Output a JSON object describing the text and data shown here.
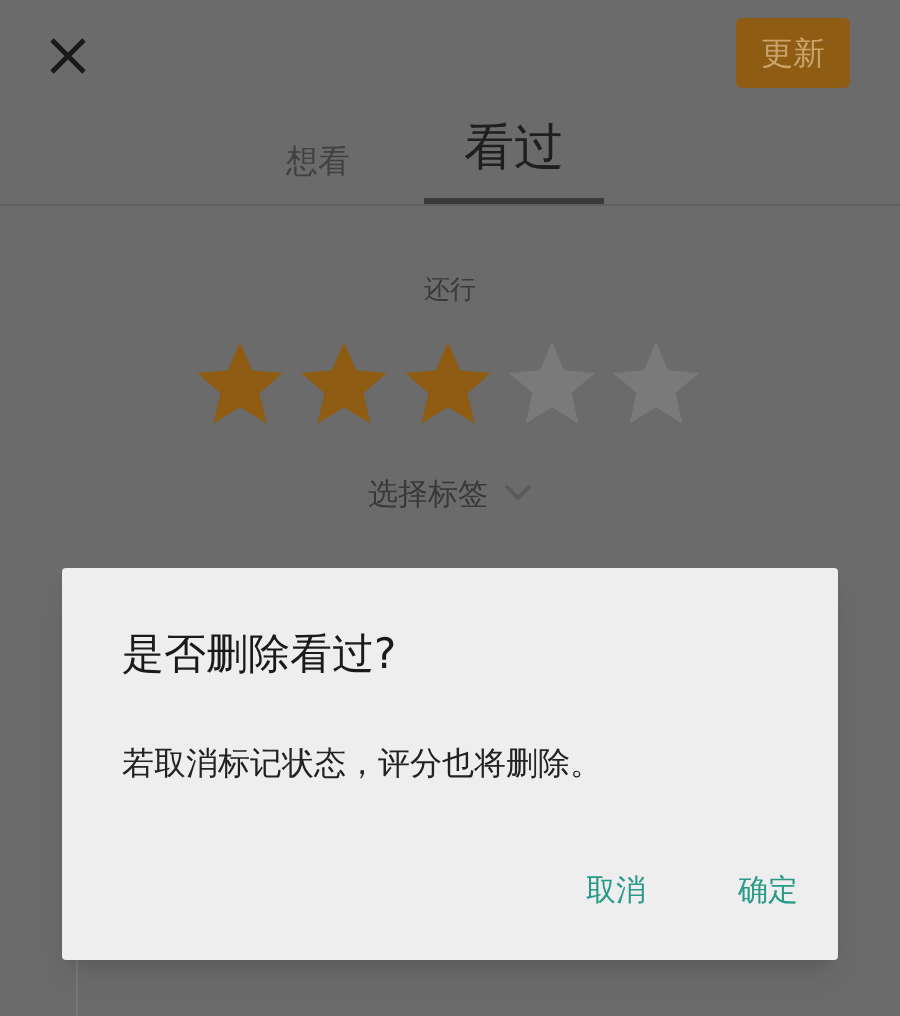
{
  "header": {
    "update_button": "更新"
  },
  "tabs": [
    {
      "label": "想看",
      "selected": false
    },
    {
      "label": "看过",
      "selected": true
    }
  ],
  "rating": {
    "label": "还行",
    "stars": 3
  },
  "tag_selector": {
    "label": "选择标签"
  },
  "dialog": {
    "title": "是否删除看过?",
    "message": "若取消标记状态，评分也将删除。",
    "buttons": [
      "取消",
      "确定"
    ]
  }
}
